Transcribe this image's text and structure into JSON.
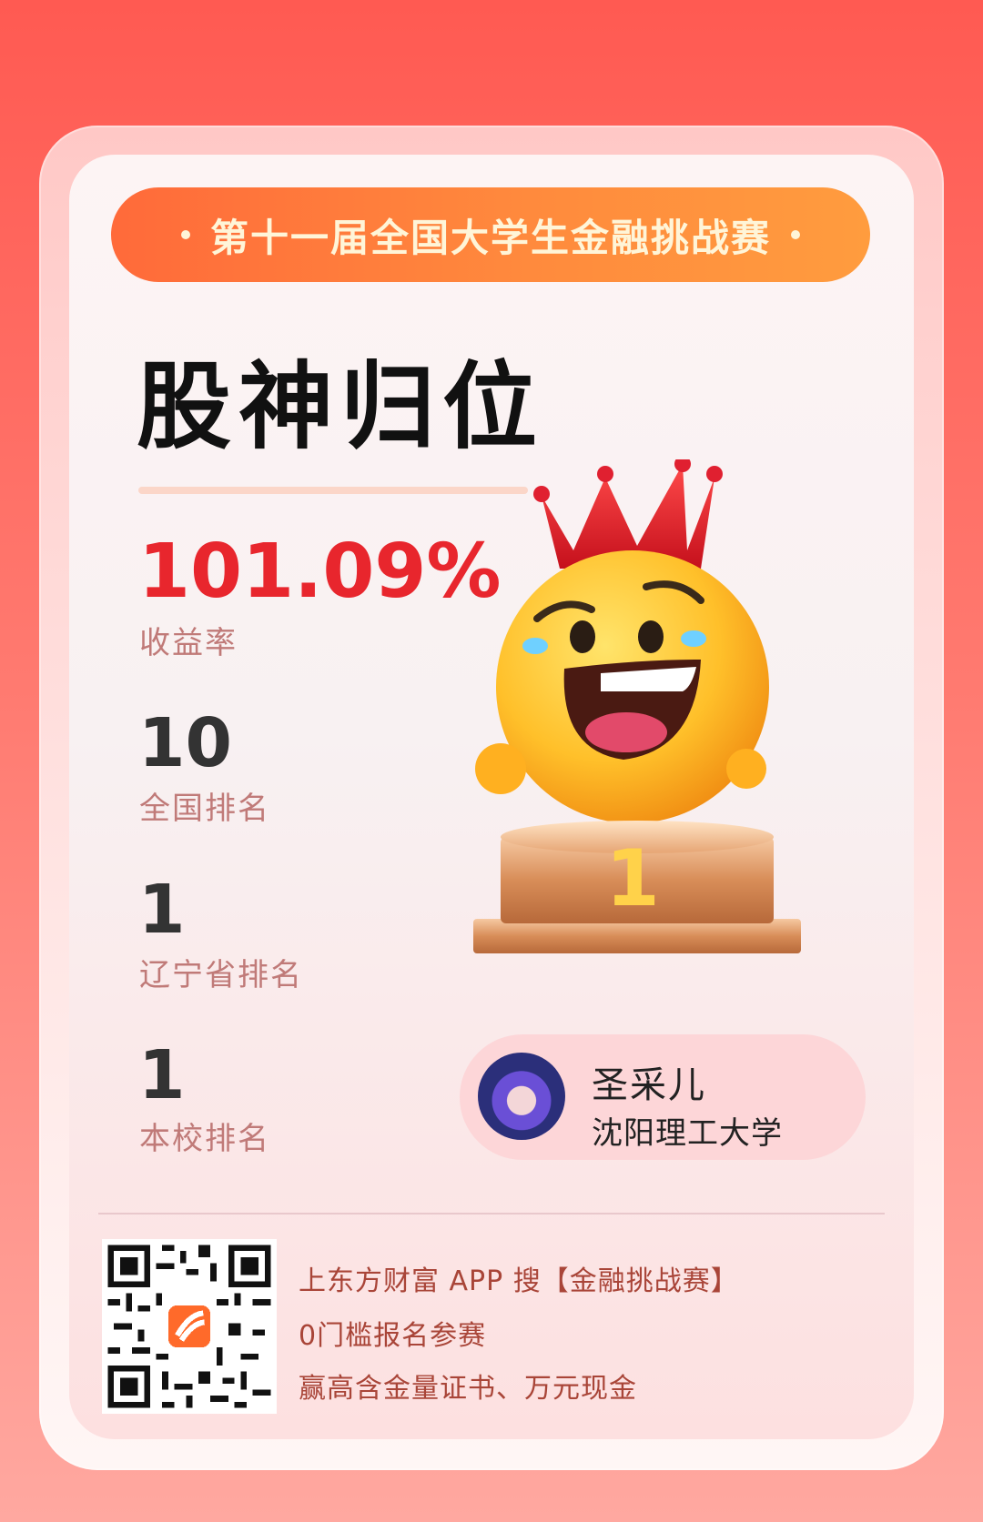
{
  "banner": {
    "title": "第十一届全国大学生金融挑战赛"
  },
  "headline": {
    "title": "股神归位"
  },
  "stats": [
    {
      "value": "101.09%",
      "label": "收益率"
    },
    {
      "value": "10",
      "label": "全国排名"
    },
    {
      "value": "1",
      "label": "辽宁省排名"
    },
    {
      "value": "1",
      "label": "本校排名"
    }
  ],
  "trophy": {
    "rank_number": "1"
  },
  "user": {
    "name": "圣采儿",
    "school": "沈阳理工大学"
  },
  "footer": {
    "line1": "上东方财富 APP 搜【金融挑战赛】",
    "line2": "0门槛报名参赛",
    "line3": "赢高含金量证书、万元现金"
  },
  "colors": {
    "accent_red": "#e8262d",
    "banner_orange": "#ff7a3a",
    "label_pink": "#c07a78"
  },
  "icons": {
    "trophy": "emoji-crown-podium-icon",
    "qr": "qr-code-icon",
    "app_logo": "eastmoney-logo-icon"
  }
}
